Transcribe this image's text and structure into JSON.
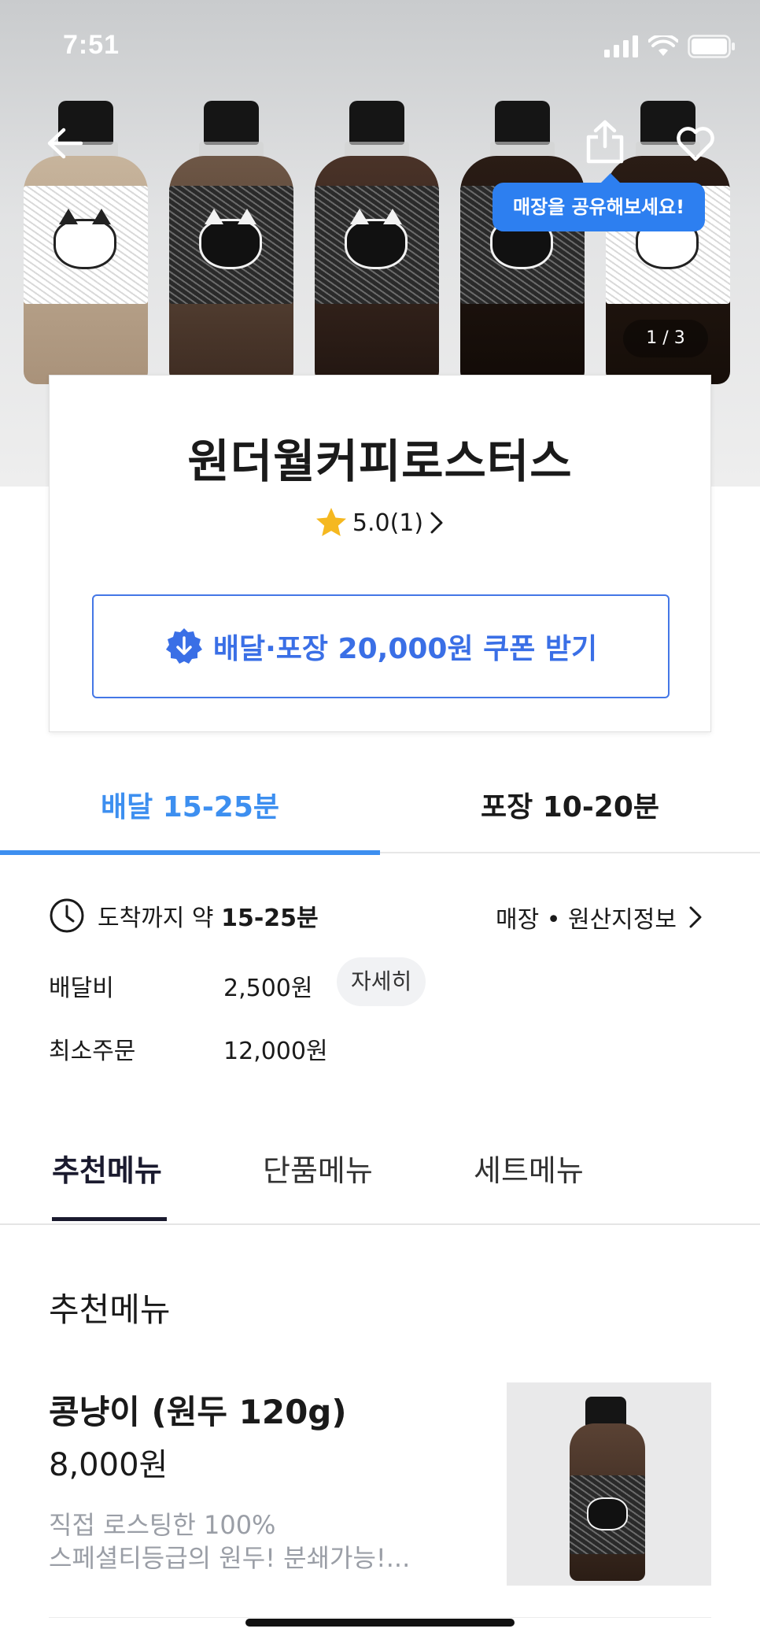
{
  "status_bar": {
    "time": "7:51"
  },
  "hero": {
    "share_tooltip": "매장을 공유해보세요!",
    "pager": "1 / 3",
    "icons": [
      "back-arrow-icon",
      "share-icon",
      "heart-icon"
    ]
  },
  "store": {
    "name": "원더월커피로스터스",
    "rating": "5.0(1)",
    "coupon_label": "배달·포장 20,000원 쿠폰 받기"
  },
  "delivery_tabs": [
    {
      "label": "배달 15-25분",
      "active": true
    },
    {
      "label": "포장 10-20분",
      "active": false
    }
  ],
  "delivery_info": {
    "arrival_prefix": "도착까지 약 ",
    "arrival_time": "15-25분",
    "origin_link": "매장 • 원산지정보",
    "fee_label": "배달비",
    "fee_value": "2,500원",
    "fee_detail_button": "자세히",
    "min_order_label": "최소주문",
    "min_order_value": "12,000원"
  },
  "menu_tabs": [
    {
      "label": "추천메뉴",
      "active": true
    },
    {
      "label": "단품메뉴",
      "active": false
    },
    {
      "label": "세트메뉴",
      "active": false
    }
  ],
  "section": {
    "title": "추천메뉴",
    "items": [
      {
        "name": "콩냥이 (원두 120g)",
        "price": "8,000원",
        "desc_line1": "직접 로스팅한 100%",
        "desc_line2": "스페셜티등급의 원두! 분쇄가능!..."
      }
    ]
  },
  "colors": {
    "accent_blue": "#3d8ff0",
    "coupon_blue": "#3a6fe6",
    "tooltip_blue": "#2d7ff0",
    "star_yellow": "#f5b820",
    "muted_text": "#9a9ea6"
  }
}
